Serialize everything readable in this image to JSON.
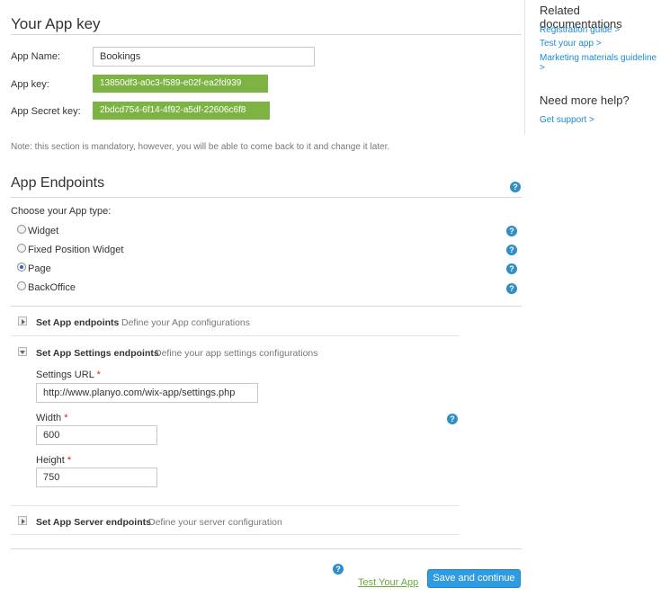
{
  "app_key_section": {
    "title": "Your App key",
    "name_label": "App Name:",
    "name_value": "Bookings",
    "key_label": "App key:",
    "key_value": "13850df3-a0c3-f589-e02f-ea2fd939",
    "secret_label": "App Secret key:",
    "secret_value": "2bdcd754-6f14-4f92-a5df-22606c6f8",
    "note": "Note: this section is mandatory, however, you will be able to come back to it and change it later."
  },
  "endpoints_section": {
    "title": "App Endpoints",
    "help_icon": "?",
    "choose_label": "Choose your App type:",
    "app_types": [
      {
        "label": "Widget",
        "checked": false
      },
      {
        "label": "Fixed Position Widget",
        "checked": false
      },
      {
        "label": "Page",
        "checked": true
      },
      {
        "label": "BackOffice",
        "checked": false
      }
    ],
    "groups": [
      {
        "title": "Set App endpoints",
        "desc": "Define your App configurations",
        "expanded": false
      },
      {
        "title": "Set App Settings endpoints",
        "desc": "Define your app settings configurations",
        "expanded": true
      },
      {
        "title": "Set App Server endpoints",
        "desc": "Define your server configuration",
        "expanded": false
      }
    ],
    "settings": {
      "url_label": "Settings URL",
      "url_value": "http://www.planyo.com/wix-app/settings.php",
      "width_label": "Width",
      "width_value": "600",
      "height_label": "Height",
      "height_value": "750",
      "required_mark": "*"
    }
  },
  "footer": {
    "test_link": "Test Your App",
    "save_button": "Save and continue"
  },
  "sidebar": {
    "docs_title": "Related documentations",
    "docs_links": [
      "Registration guide >",
      "Test your app >",
      "Marketing materials guideline >"
    ],
    "help_title": "Need more help?",
    "support_link": "Get support >"
  },
  "colors": {
    "accent_blue": "#2f9be0",
    "key_green": "#7cb342",
    "link_blue": "#1a8bd0"
  }
}
